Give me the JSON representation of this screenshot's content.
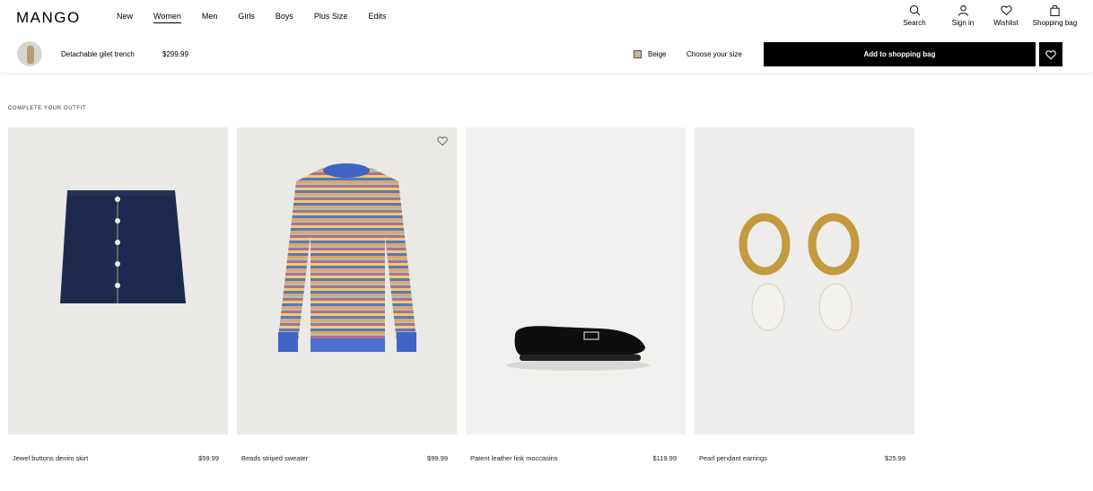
{
  "brand": "MANGO",
  "nav": {
    "links": [
      "New",
      "Women",
      "Men",
      "Girls",
      "Boys",
      "Plus Size",
      "Edits"
    ],
    "active": "Women"
  },
  "header_icons": {
    "search": "Search",
    "signin": "Sign in",
    "wishlist": "Wishlist",
    "bag": "Shopping bag"
  },
  "product_bar": {
    "name": "Detachable gilet trench",
    "price": "$299.99",
    "color": "Beige",
    "color_hex": "#c6b79a",
    "size_prompt": "Choose your size",
    "add_button": "Add to shopping bag"
  },
  "section": {
    "title": "COMPLETE YOUR OUTFIT"
  },
  "products": [
    {
      "name": "Jewel buttons denim skirt",
      "price": "$59.99"
    },
    {
      "name": "Beads striped sweater",
      "price": "$99.99"
    },
    {
      "name": "Patent leather link moccasins",
      "price": "$119.99"
    },
    {
      "name": "Pearl pendant earrings",
      "price": "$25.99"
    }
  ]
}
